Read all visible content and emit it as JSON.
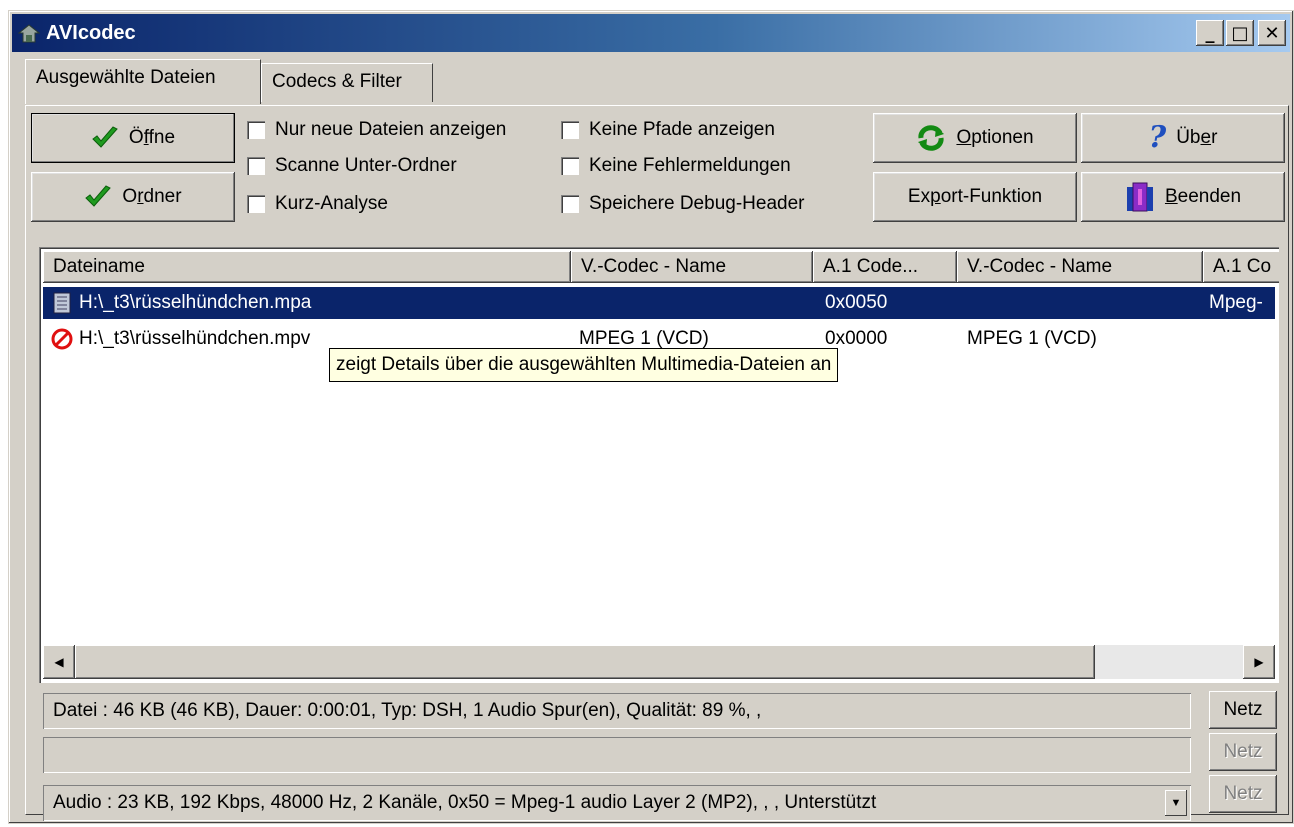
{
  "window": {
    "title": "AVIcodec",
    "controls": {
      "minimize": "_",
      "maximize": "□",
      "close": "✕"
    }
  },
  "tabs": [
    {
      "label": "Ausgewählte Dateien",
      "active": true
    },
    {
      "label": "Codecs & Filter",
      "active": false
    }
  ],
  "toolbar": {
    "open": {
      "pre": "Ö",
      "accel": "f",
      "post": "fne"
    },
    "folder": {
      "pre": "O",
      "accel": "r",
      "post": "dner"
    },
    "options": {
      "pre": "",
      "accel": "O",
      "post": "ptionen"
    },
    "about": {
      "pre": "Üb",
      "accel": "e",
      "post": "r"
    },
    "export": {
      "pre": "Ex",
      "accel": "p",
      "post": "ort-Funktion"
    },
    "quit": {
      "pre": "",
      "accel": "B",
      "post": "eenden"
    }
  },
  "checkboxes": {
    "only_new": "Nur neue Dateien anzeigen",
    "scan_sub": "Scanne Unter-Ordner",
    "short_analysis": "Kurz-Analyse",
    "no_paths": "Keine Pfade anzeigen",
    "no_errors": "Keine Fehlermeldungen",
    "debug_header": "Speichere Debug-Header"
  },
  "list": {
    "columns": [
      "Dateiname",
      "V.-Codec - Name",
      "A.1 Code...",
      "V.-Codec - Name",
      "A.1 Co"
    ],
    "rows": [
      {
        "file": "H:\\_t3\\rüsselhündchen.mpa",
        "vcodec": "",
        "a1code": "0x0050",
        "vcodec2": "",
        "a1": "Mpeg-",
        "icon": "audio-file-icon"
      },
      {
        "file": "H:\\_t3\\rüsselhündchen.mpv",
        "vcodec": "MPEG 1 (VCD)",
        "a1code": "0x0000",
        "vcodec2": "MPEG 1 (VCD)",
        "a1": "",
        "icon": "error-icon"
      }
    ]
  },
  "tooltip": "zeigt Details über die ausgewählten Multimedia-Dateien an",
  "info": {
    "file_line": "Datei :  46 KB (46 KB),  Dauer: 0:00:01,  Typ: DSH,  1 Audio Spur(en),  Qualität: 89 %, ,",
    "video_line": "",
    "audio_line": "Audio :  23 KB,  192 Kbps,  48000 Hz,  2 Kanäle,  0x50 = Mpeg-1 audio Layer 2 (MP2),  , ,   Unterstützt"
  },
  "netz_label": "Netz",
  "colors": {
    "face": "#d4d0c8",
    "selection": "#0a246a",
    "title_start": "#0a246a",
    "title_end": "#a6caf0"
  }
}
